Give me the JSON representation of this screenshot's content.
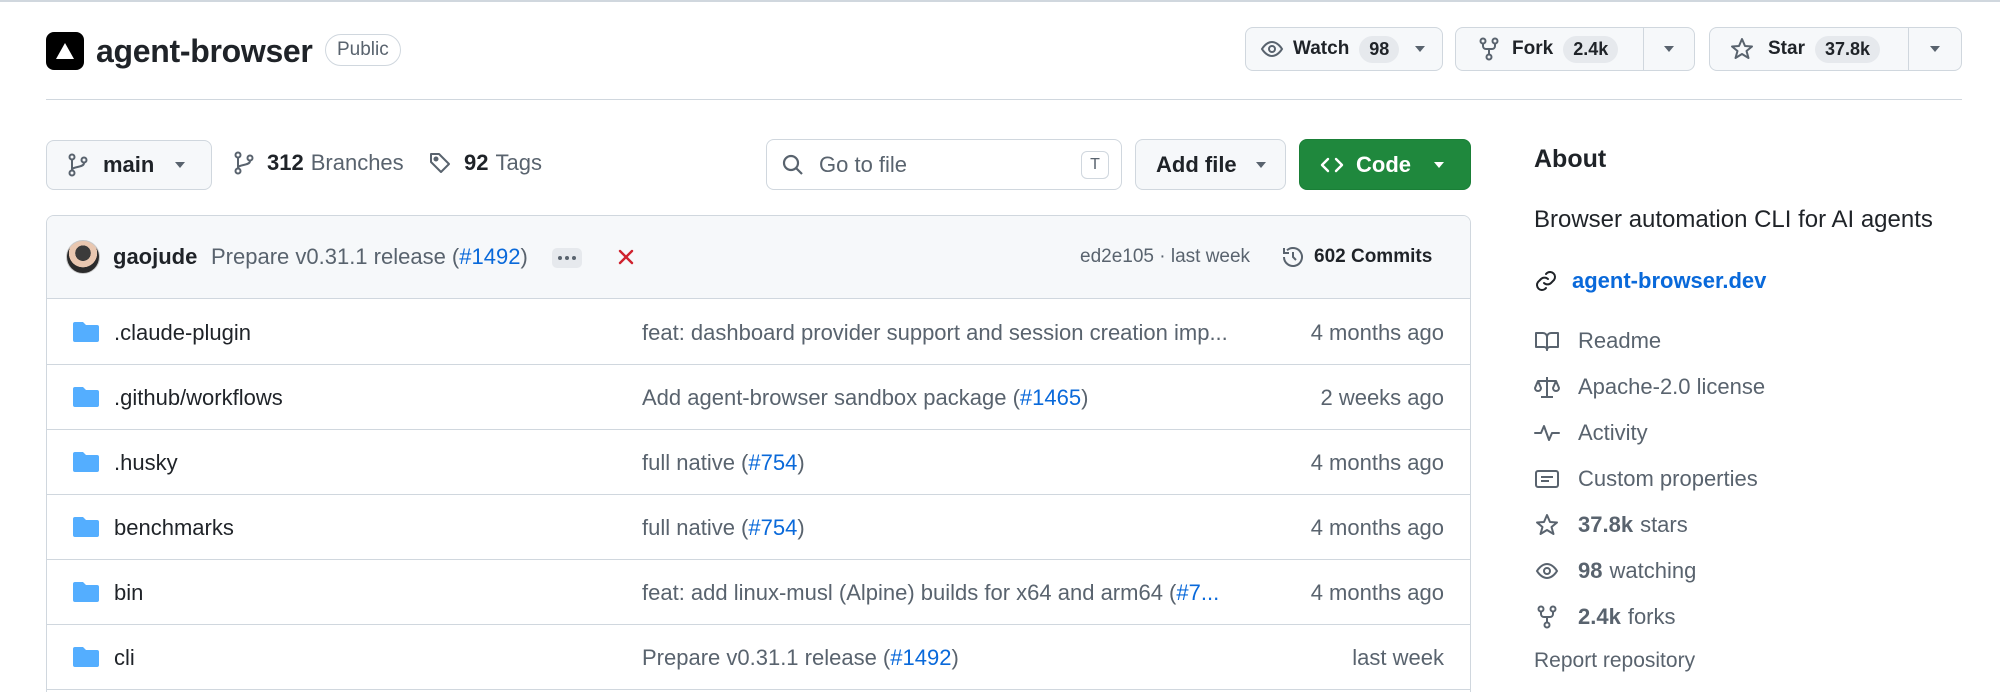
{
  "repo": {
    "name": "agent-browser",
    "visibility": "Public"
  },
  "header_actions": {
    "watch": {
      "label": "Watch",
      "count": "98"
    },
    "fork": {
      "label": "Fork",
      "count": "2.4k"
    },
    "star": {
      "label": "Star",
      "count": "37.8k"
    }
  },
  "toolbar": {
    "branch": "main",
    "branches": {
      "count": "312",
      "label": "Branches"
    },
    "tags": {
      "count": "92",
      "label": "Tags"
    },
    "search_placeholder": "Go to file",
    "search_shortcut": "T",
    "add_file": "Add file",
    "code": "Code"
  },
  "latest_commit": {
    "author": "gaojude",
    "message": "Prepare v0.31.1 release (",
    "pr": "#1492",
    "message_suffix": ")",
    "sha_time": "ed2e105 · last week",
    "commits": "602 Commits",
    "status": "failed"
  },
  "files": [
    {
      "name": ".claude-plugin",
      "msg": "feat: dashboard provider support and session creation imp...",
      "pr": "",
      "suffix": "",
      "age": "4 months ago"
    },
    {
      "name": ".github/workflows",
      "msg": "Add agent-browser sandbox package (",
      "pr": "#1465",
      "suffix": ")",
      "age": "2 weeks ago"
    },
    {
      "name": ".husky",
      "msg": "full native (",
      "pr": "#754",
      "suffix": ")",
      "age": "4 months ago"
    },
    {
      "name": "benchmarks",
      "msg": "full native (",
      "pr": "#754",
      "suffix": ")",
      "age": "4 months ago"
    },
    {
      "name": "bin",
      "msg": "feat: add linux-musl (Alpine) builds for x64 and arm64 (",
      "pr": "#7...",
      "suffix": "",
      "age": "4 months ago"
    },
    {
      "name": "cli",
      "msg": "Prepare v0.31.1 release (",
      "pr": "#1492",
      "suffix": ")",
      "age": "last week"
    }
  ],
  "about": {
    "title": "About",
    "description": "Browser automation CLI for AI agents",
    "website": "agent-browser.dev",
    "readme": "Readme",
    "license": "Apache-2.0 license",
    "activity": "Activity",
    "custom_properties": "Custom properties",
    "stars_count": "37.8k",
    "stars_label": "stars",
    "watching_count": "98",
    "watching_label": "watching",
    "forks_count": "2.4k",
    "forks_label": "forks",
    "report": "Report repository"
  },
  "colors": {
    "accent_link": "#0969da",
    "code_button": "#1f883d",
    "folder": "#54aeff",
    "status_fail": "#cf222e"
  },
  "icons": [
    "repo-logo-icon",
    "eye-icon",
    "fork-icon",
    "star-icon",
    "chevron-down-icon",
    "branch-icon",
    "tag-icon",
    "search-icon",
    "code-icon",
    "kebab-icon",
    "x-icon",
    "history-icon",
    "folder-icon",
    "link-icon",
    "book-icon",
    "law-icon",
    "pulse-icon",
    "note-icon"
  ]
}
